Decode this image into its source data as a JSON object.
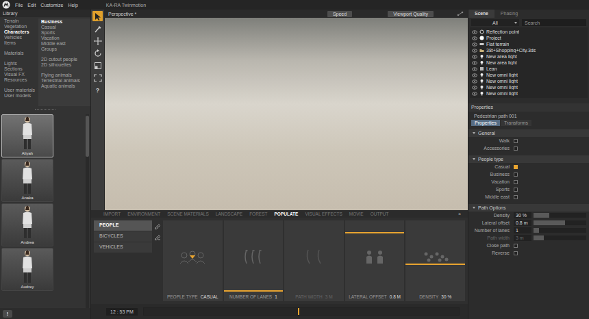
{
  "window": {
    "title": "KA-RA Twinmotion"
  },
  "menu": [
    "File",
    "Edit",
    "Customize",
    "Help"
  ],
  "library": {
    "title": "Library",
    "categories": [
      [
        {
          "label": "Terrain",
          "selected": false
        },
        {
          "label": "Vegetation",
          "selected": false
        },
        {
          "label": "Characters",
          "selected": true
        },
        {
          "label": "Vehicles",
          "selected": false
        },
        {
          "label": "Items",
          "selected": false
        }
      ],
      [
        {
          "label": "Materials",
          "selected": false
        }
      ],
      [
        {
          "label": "Lights",
          "selected": false
        },
        {
          "label": "Sections",
          "selected": false
        },
        {
          "label": "Visual FX",
          "selected": false
        },
        {
          "label": "Resources",
          "selected": false
        }
      ],
      [
        {
          "label": "User materials",
          "selected": false
        },
        {
          "label": "User models",
          "selected": false
        }
      ]
    ],
    "subcategories": [
      [
        {
          "label": "Business",
          "selected": true
        },
        {
          "label": "Casual",
          "selected": false
        },
        {
          "label": "Sports",
          "selected": false
        },
        {
          "label": "Vacation",
          "selected": false
        },
        {
          "label": "Middle east",
          "selected": false
        },
        {
          "label": "Groups",
          "selected": false
        }
      ],
      [
        {
          "label": "2D cutout people",
          "selected": false
        },
        {
          "label": "2D silhouettes",
          "selected": false
        }
      ],
      [
        {
          "label": "Flying animals",
          "selected": false
        },
        {
          "label": "Terrestrial animals",
          "selected": false
        },
        {
          "label": "Aquatic animals",
          "selected": false
        }
      ]
    ],
    "characters": [
      {
        "name": "Aliyah",
        "selected": true
      },
      {
        "name": "Anaka",
        "selected": false
      },
      {
        "name": "Andrea",
        "selected": false
      },
      {
        "name": "Audrey",
        "selected": false
      }
    ],
    "alert": "!"
  },
  "tools": [
    {
      "kind": "select",
      "selected": true
    },
    {
      "kind": "paint",
      "selected": false
    },
    {
      "kind": "move",
      "selected": false
    },
    {
      "kind": "rotate",
      "selected": false
    },
    {
      "kind": "scale",
      "selected": false
    },
    {
      "kind": "fit",
      "selected": false
    },
    {
      "kind": "help",
      "glyph": "?",
      "selected": false
    }
  ],
  "viewport": {
    "camera": "Perspective *",
    "buttons": [
      "Speed",
      "Viewport Quality"
    ]
  },
  "modules": {
    "tabs": [
      {
        "label": "IMPORT",
        "selected": false
      },
      {
        "label": "ENVIRONMENT",
        "selected": false
      },
      {
        "label": "SCENE MATERIALS",
        "selected": false
      },
      {
        "label": "LANDSCAPE",
        "selected": false
      },
      {
        "label": "FOREST",
        "selected": false
      },
      {
        "label": "POPULATE",
        "selected": true
      },
      {
        "label": "VISUAL EFFECTS",
        "selected": false
      },
      {
        "label": "MOVIE",
        "selected": false
      },
      {
        "label": "OUTPUT",
        "selected": false
      }
    ],
    "close": "×"
  },
  "populate": {
    "categories": [
      {
        "label": "PEOPLE",
        "selected": true
      },
      {
        "label": "BICYCLES",
        "selected": false
      },
      {
        "label": "VEHICLES",
        "selected": false
      }
    ],
    "params": [
      {
        "kind": "choice",
        "label": "PEOPLE TYPE",
        "value": "CASUAL",
        "disabled": false
      },
      {
        "kind": "slider",
        "label": "NUMBER OF LANES",
        "value": "1",
        "level": 0.03,
        "disabled": false
      },
      {
        "kind": "inactive",
        "label": "PATH WIDTH",
        "value": "3 M",
        "disabled": true
      },
      {
        "kind": "slider",
        "label": "LATERAL OFFSET",
        "value": "0.8 M",
        "level": 0.83,
        "disabled": false
      },
      {
        "kind": "slider",
        "label": "DENSITY",
        "value": "30 %",
        "level": 0.4,
        "disabled": false
      }
    ]
  },
  "timeline": {
    "time": "12 : 53 PM",
    "level": 0.49
  },
  "scene": {
    "tabs": [
      {
        "label": "Scene",
        "selected": true
      },
      {
        "label": "Phasing",
        "selected": false
      }
    ],
    "filter": "All",
    "search": {
      "placeholder": "Search"
    },
    "tree": [
      {
        "label": "Reflection point",
        "kind": "point",
        "visible": true
      },
      {
        "label": "Project",
        "kind": "group",
        "visible": true
      },
      {
        "label": "Flat terrain",
        "kind": "terrain",
        "visible": true
      },
      {
        "label": "38t+Shopping+City.3ds",
        "kind": "folder",
        "visible": true
      },
      {
        "label": "New area light",
        "kind": "light",
        "visible": true
      },
      {
        "label": "New area light",
        "kind": "light",
        "visible": true
      },
      {
        "label": "Lean",
        "kind": "object",
        "visible": true
      },
      {
        "label": "New omni light",
        "kind": "light",
        "visible": true
      },
      {
        "label": "New omni light",
        "kind": "light",
        "visible": true
      },
      {
        "label": "New omni light",
        "kind": "light",
        "visible": true
      },
      {
        "label": "New omni light",
        "kind": "light",
        "visible": true
      }
    ]
  },
  "properties": {
    "title": "Properties",
    "object": "Pedestrian path 001",
    "tabs": [
      {
        "label": "Properties",
        "selected": true
      },
      {
        "label": "Transforms",
        "selected": false
      }
    ],
    "sections": [
      {
        "title": "General",
        "rows": [
          {
            "kind": "checkbox",
            "label": "Walk",
            "checked": false,
            "disabled": false
          },
          {
            "kind": "checkbox",
            "label": "Accessories",
            "checked": false,
            "disabled": false
          }
        ]
      },
      {
        "title": "People type",
        "rows": [
          {
            "kind": "checkbox",
            "label": "Casual",
            "checked": true,
            "disabled": false
          },
          {
            "kind": "checkbox",
            "label": "Business",
            "checked": false,
            "disabled": false
          },
          {
            "kind": "checkbox",
            "label": "Vacation",
            "checked": false,
            "disabled": false
          },
          {
            "kind": "checkbox",
            "label": "Sports",
            "checked": false,
            "disabled": false
          },
          {
            "kind": "checkbox",
            "label": "Middle east",
            "checked": false,
            "disabled": false
          }
        ]
      },
      {
        "title": "Path Options",
        "rows": [
          {
            "kind": "slider",
            "label": "Density",
            "value": "30 %",
            "level": 0.3,
            "disabled": false
          },
          {
            "kind": "slider",
            "label": "Lateral offset",
            "value": "0.8 m",
            "level": 0.6,
            "disabled": false
          },
          {
            "kind": "slider",
            "label": "Number of lanes",
            "value": "1",
            "level": 0.1,
            "disabled": false
          },
          {
            "kind": "slider",
            "label": "Path width",
            "value": "3 m",
            "level": 0.2,
            "disabled": true
          },
          {
            "kind": "checkbox",
            "label": "Close path",
            "checked": false,
            "disabled": false
          },
          {
            "kind": "checkbox",
            "label": "Reverse",
            "checked": false,
            "disabled": false
          }
        ]
      }
    ]
  }
}
